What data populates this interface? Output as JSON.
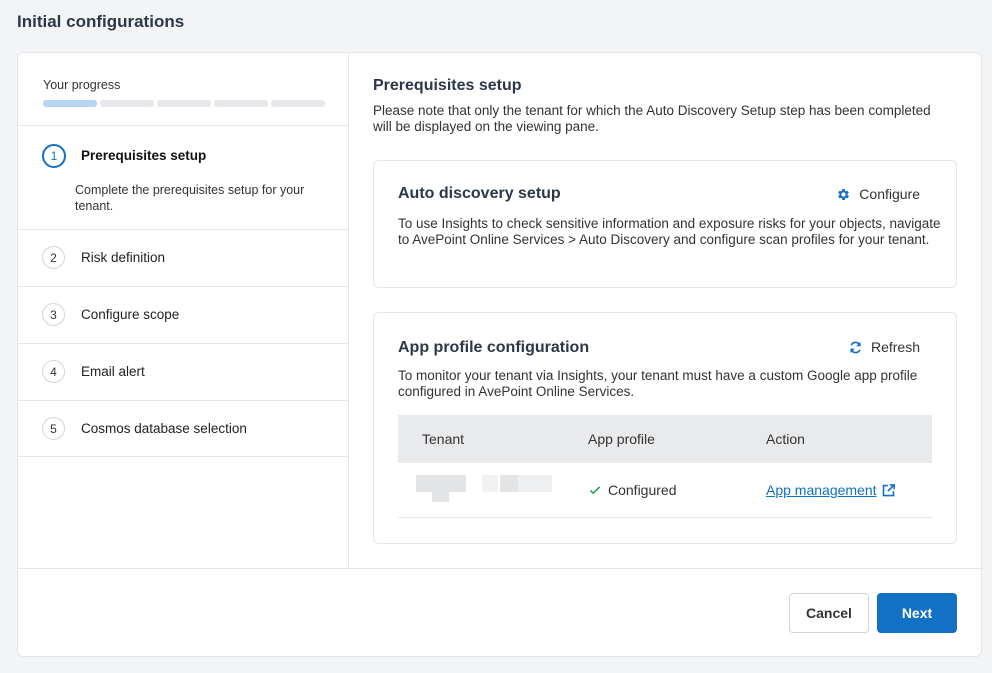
{
  "page": {
    "title": "Initial configurations"
  },
  "sidebar": {
    "progress_label": "Your progress",
    "progress": {
      "completed_segments": 1,
      "total_segments": 5
    },
    "steps": [
      {
        "number": "1",
        "label": "Prerequisites setup",
        "description": "Complete the prerequisites setup for your tenant.",
        "active": true
      },
      {
        "number": "2",
        "label": "Risk definition"
      },
      {
        "number": "3",
        "label": "Configure scope"
      },
      {
        "number": "4",
        "label": "Email alert"
      },
      {
        "number": "5",
        "label": "Cosmos database selection"
      }
    ]
  },
  "main": {
    "title": "Prerequisites setup",
    "note": "Please note that only the tenant for which the Auto Discovery Setup step has been completed will be displayed on the viewing pane.",
    "auto_discovery": {
      "title": "Auto discovery setup",
      "action_label": "Configure",
      "action_icon": "gear-icon",
      "text": "To use Insights to check sensitive information and exposure risks for your objects, navigate to AvePoint Online Services > Auto Discovery and configure scan profiles for your tenant."
    },
    "app_profile": {
      "title": "App profile configuration",
      "action_label": "Refresh",
      "action_icon": "refresh-icon",
      "text": "To monitor your tenant via Insights, your tenant must have a custom Google app profile configured in AvePoint Online Services.",
      "table": {
        "columns": [
          "Tenant",
          "App profile",
          "Action"
        ],
        "rows": [
          {
            "tenant": "",
            "app_profile": "Configured",
            "action": "App management"
          }
        ]
      }
    }
  },
  "footer": {
    "cancel_label": "Cancel",
    "next_label": "Next"
  },
  "colors": {
    "accent": "#1271c4",
    "success": "#2e9d5b",
    "progress_fill": "#b7d5f3"
  }
}
